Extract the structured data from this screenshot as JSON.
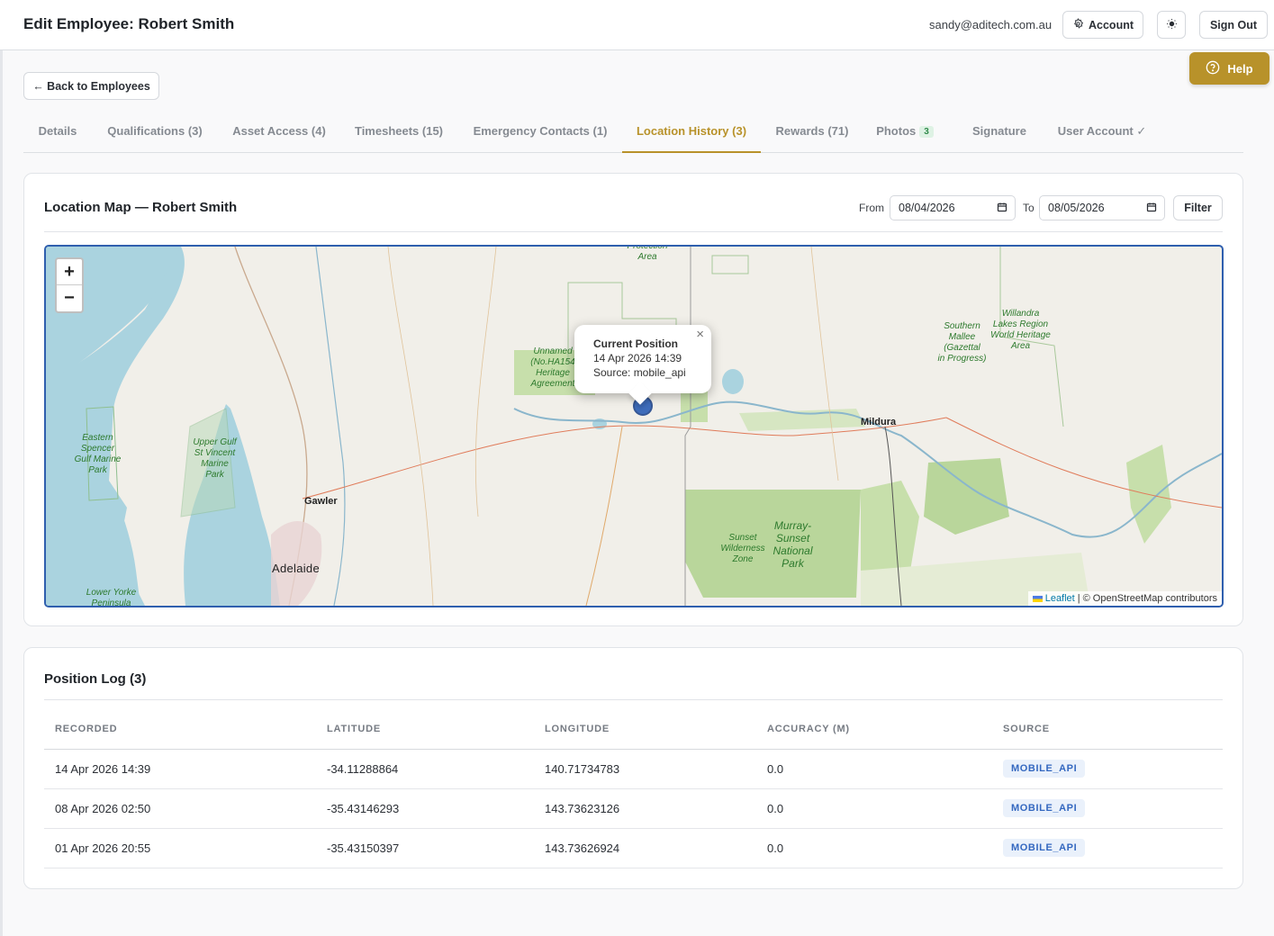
{
  "header": {
    "title": "Edit Employee: Robert Smith",
    "user_email": "sandy@aditech.com.au",
    "account_label": "Account",
    "sign_out_label": "Sign Out",
    "help_label": "Help"
  },
  "back_label": "← Back to Employees",
  "tabs": [
    {
      "label": "Details"
    },
    {
      "label": "Qualifications (3)"
    },
    {
      "label": "Asset Access (4)"
    },
    {
      "label": "Timesheets (15)"
    },
    {
      "label": "Emergency Contacts (1)"
    },
    {
      "label": "Location History (3)",
      "active": true
    },
    {
      "label": "Rewards (71)"
    },
    {
      "label": "Photos",
      "badge": "3"
    },
    {
      "label": "Signature"
    },
    {
      "label": "User Account ✓"
    }
  ],
  "map_card": {
    "title": "Location Map — Robert Smith",
    "from_label": "From",
    "from_value": "08/04/2026",
    "to_label": "To",
    "to_value": "08/05/2026",
    "filter_label": "Filter",
    "zoom_in": "+",
    "zoom_out": "−",
    "popup": {
      "title": "Current Position",
      "time": "14 Apr 2026 14:39",
      "source": "Source: mobile_api",
      "close": "×"
    },
    "attribution_leaflet": "Leaflet",
    "attribution_rest": "| © OpenStreetMap contributors",
    "places": {
      "mildura": "Mildura",
      "gawler": "Gawler",
      "adelaide": "Adelaide"
    },
    "parks": {
      "protection_1": "Protection",
      "protection_2": "Area",
      "unnamed_1": "Unnamed",
      "unnamed_2": "(No.HA154",
      "unnamed_3": "Heritage",
      "unnamed_4": "Agreement",
      "southern_1": "Southern",
      "southern_2": "Mallee",
      "southern_3": "(Gazettal",
      "southern_4": "in Progress)",
      "willandra_1": "Willandra",
      "willandra_2": "Lakes Region",
      "willandra_3": "World Heritage",
      "willandra_4": "Area",
      "eastern_1": "Eastern",
      "eastern_2": "Spencer",
      "eastern_3": "Gulf Marine",
      "eastern_4": "Park",
      "upper_1": "Upper Gulf",
      "upper_2": "St Vincent",
      "upper_3": "Marine",
      "upper_4": "Park",
      "sunset_1": "Sunset",
      "sunset_2": "Wilderness",
      "sunset_3": "Zone",
      "murray_1": "Murray-",
      "murray_2": "Sunset",
      "murray_3": "National",
      "murray_4": "Park",
      "yorke_1": "Lower Yorke",
      "yorke_2": "Peninsula"
    }
  },
  "log_card": {
    "title": "Position Log (3)",
    "columns": [
      "RECORDED",
      "LATITUDE",
      "LONGITUDE",
      "ACCURACY (M)",
      "SOURCE"
    ],
    "rows": [
      {
        "recorded": "14 Apr 2026 14:39",
        "latitude": "-34.11288864",
        "longitude": "140.71734783",
        "accuracy": "0.0",
        "source": "MOBILE_API"
      },
      {
        "recorded": "08 Apr 2026 02:50",
        "latitude": "-35.43146293",
        "longitude": "143.73623126",
        "accuracy": "0.0",
        "source": "MOBILE_API"
      },
      {
        "recorded": "01 Apr 2026 20:55",
        "latitude": "-35.43150397",
        "longitude": "143.73626924",
        "accuracy": "0.0",
        "source": "MOBILE_API"
      }
    ]
  }
}
